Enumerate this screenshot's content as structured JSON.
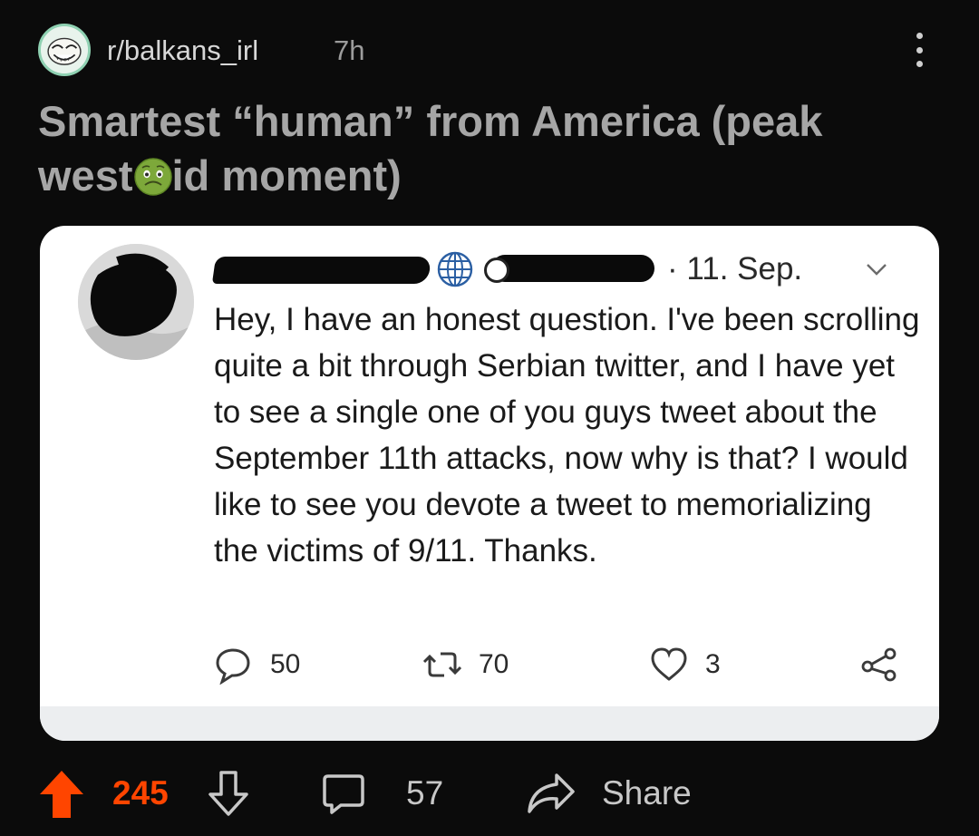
{
  "post": {
    "subreddit": "r/balkans_irl",
    "age": "7h",
    "title_part1": "Smartest “human” from America (peak west",
    "title_emoji": "nauseated-face-emoji",
    "title_part2": "id moment)",
    "score": "245",
    "comments_count": "57",
    "share_label": "Share",
    "upvote_color": "#ff4500"
  },
  "tweet": {
    "date": "· 11. Sep.",
    "text": "Hey, I have an honest question. I've been scrolling quite a bit through Serbian twitter, and I have yet to see a single one of you guys tweet about the September 11th attacks, now why is that? I would like to see you devote a tweet to memorializing the victims of 9/11. Thanks.",
    "replies": "50",
    "retweets": "70",
    "likes": "3",
    "verified_icon": "globe-icon"
  }
}
